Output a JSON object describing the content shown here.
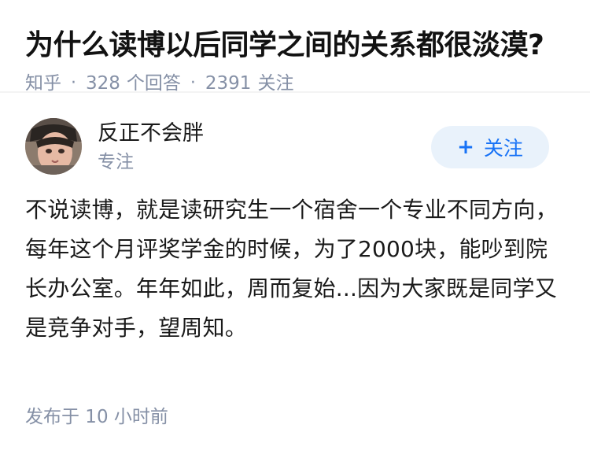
{
  "question": {
    "title": "为什么读博以后同学之间的关系都很淡漠?",
    "source": "知乎",
    "answer_count": "328",
    "answer_label": "个回答",
    "follower_count": "2391",
    "follower_label": "关注",
    "separator": "·"
  },
  "answer": {
    "author_name": "反正不会胖",
    "author_headline": "专注",
    "follow_icon": "plus-icon",
    "follow_icon_glyph": "+",
    "follow_label": "关注",
    "content": "不说读博，就是读研究生一个宿舍一个专业不同方向，每年这个月评奖学金的时候，为了2000块，能吵到院长办公室。年年如此，周而复始...因为大家既是同学又是竞争对手，望周知。",
    "publish_time": "发布于  10 小时前"
  },
  "colors": {
    "meta": "#8590a6",
    "follow_bg": "#e9f2fb",
    "follow_text": "#1772f6",
    "text": "#1a1a1a"
  }
}
